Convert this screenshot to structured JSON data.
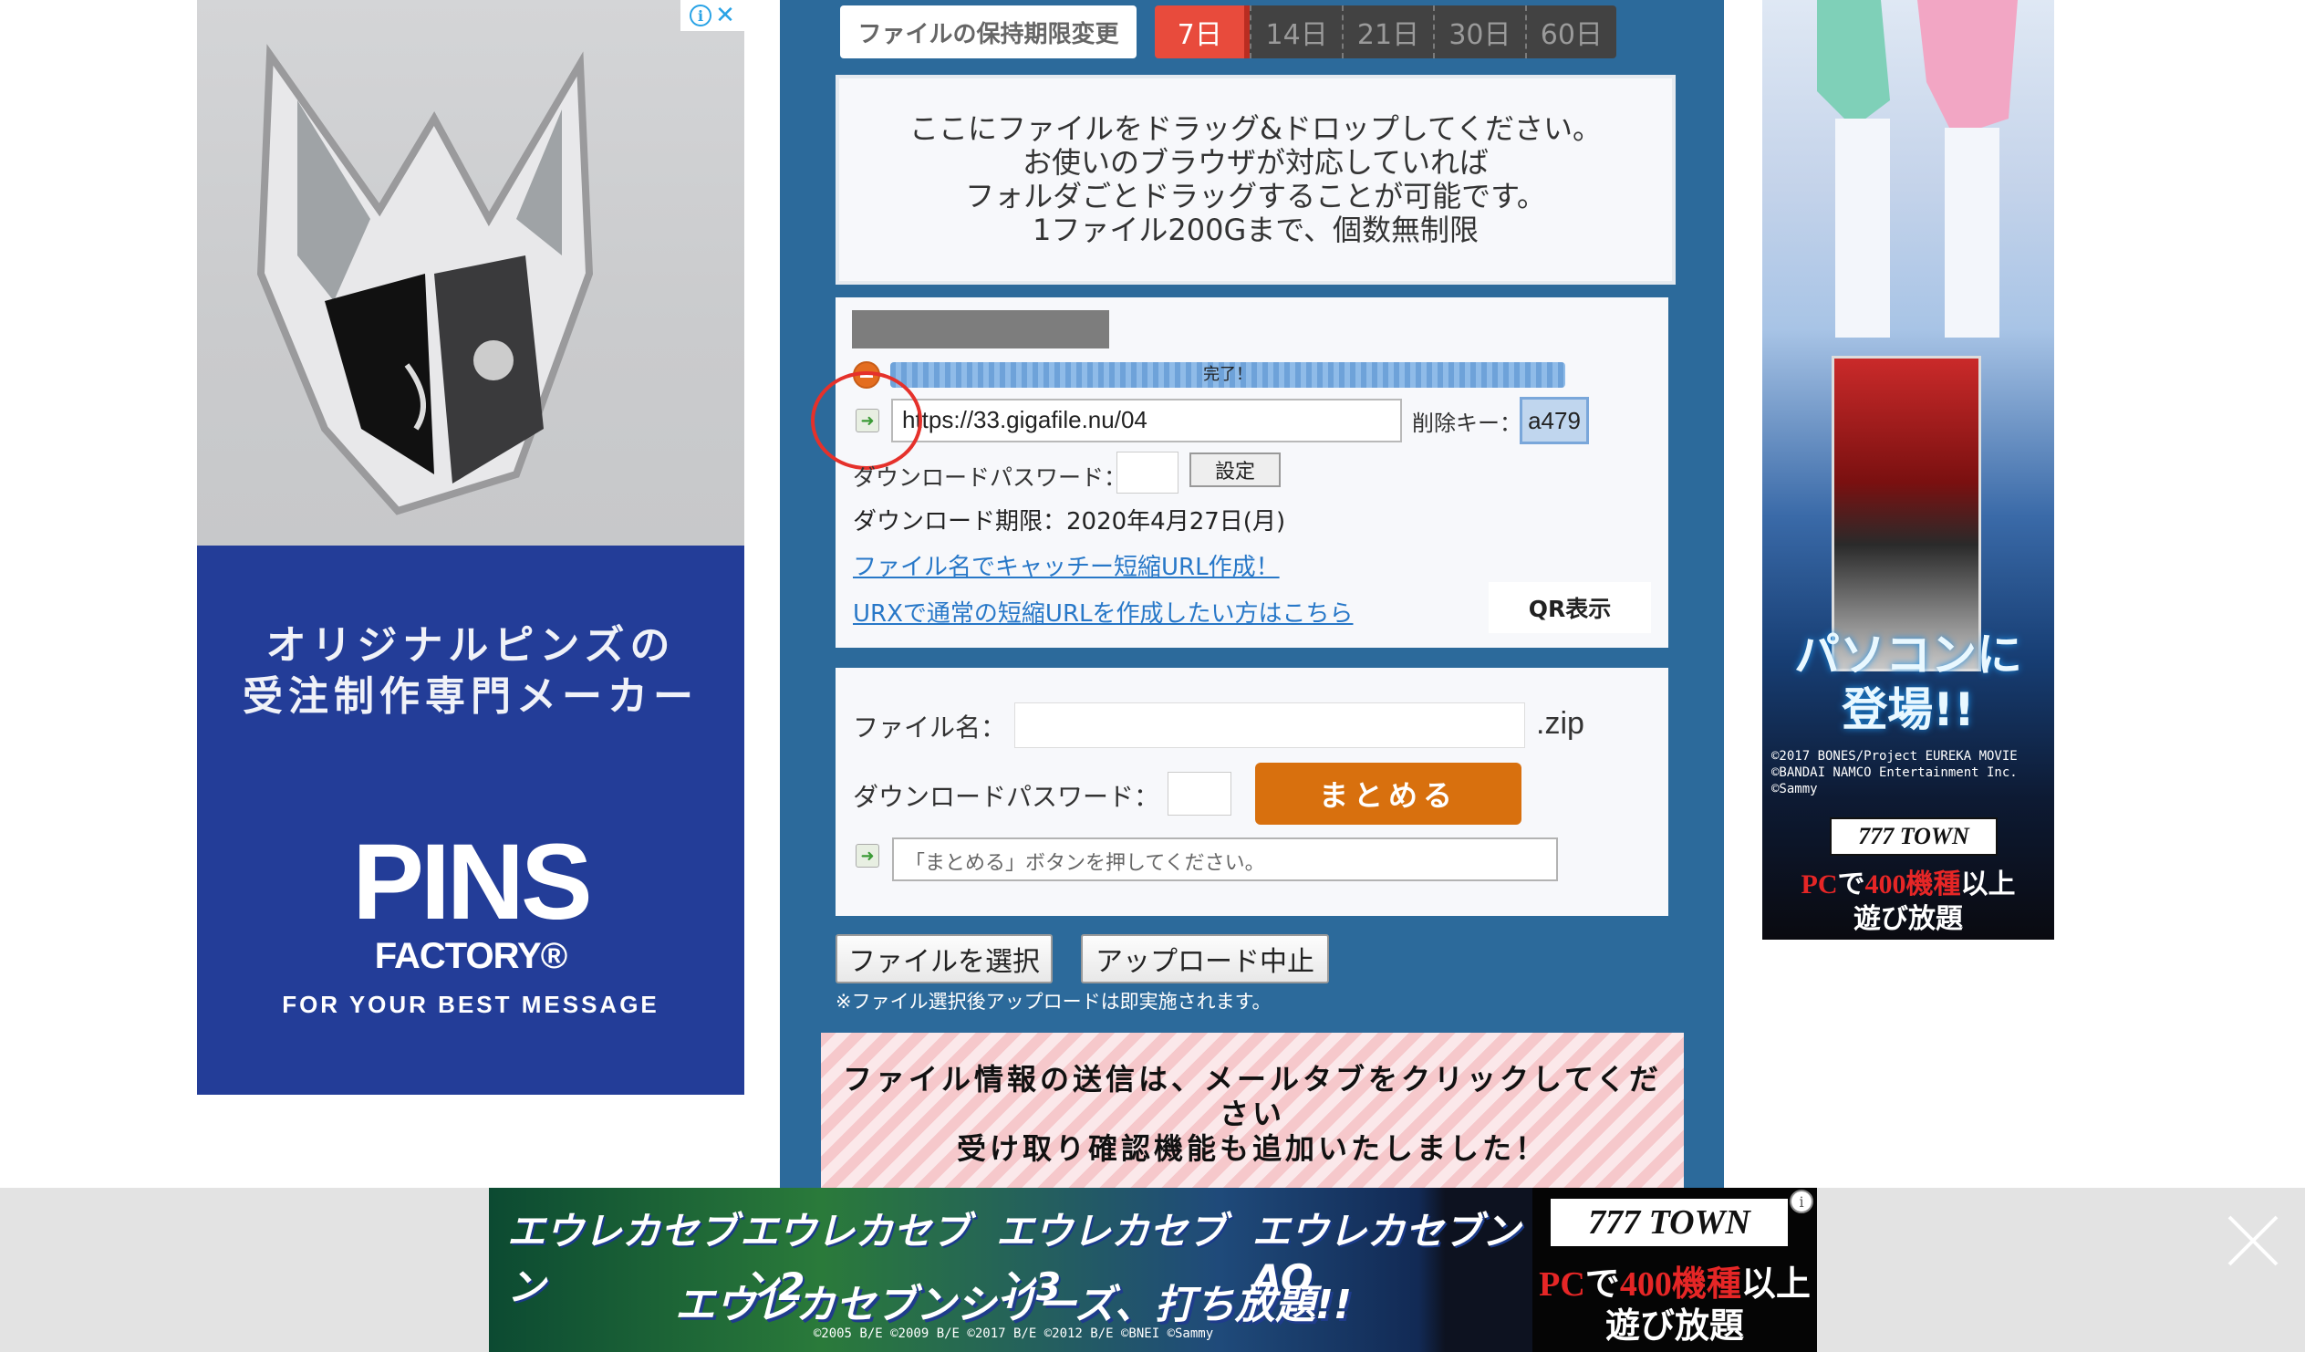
{
  "left_ad": {
    "tagline_line1": "オリジナルピンズの",
    "tagline_line2": "受注制作専門メーカー",
    "brand": "PINS",
    "brand_sub": "FACTORY®",
    "slogan": "FOR YOUR BEST MESSAGE"
  },
  "retention": {
    "label": "ファイルの保持期限変更",
    "options": [
      "7日",
      "14日",
      "21日",
      "30日",
      "60日"
    ],
    "selected": "7日"
  },
  "dropzone": {
    "line1": "ここにファイルをドラッグ&ドロップしてください。",
    "line2": "お使いのブラウザが対応していれば",
    "line3": "フォルダごとドラッグすることが可能です。",
    "line4": "1ファイル200Gまで、個数無制限"
  },
  "upload": {
    "progress_label": "完了！",
    "progress_percent": 100,
    "url": "https://33.gigafile.nu/04",
    "delete_key_label": "削除キー：",
    "delete_key": "a479",
    "download_password_label": "ダウンロードパスワード：",
    "set_button": "設定",
    "deadline": "ダウンロード期限：2020年4月27日(月)",
    "link_catchy": "ファイル名でキャッチー短縮URL作成！",
    "link_urx": "URXで通常の短縮URLを作成したい方はこちら",
    "qr_button": "QR表示"
  },
  "bundle": {
    "filename_label": "ファイル名：",
    "ext": ".zip",
    "password_label": "ダウンロードパスワード：",
    "button": "まとめる",
    "message": "「まとめる」ボタンを押してください。"
  },
  "actions": {
    "select_files": "ファイルを選択",
    "abort_upload": "アップロード中止",
    "note": "※ファイル選択後アップロードは即実施されます。"
  },
  "notice": {
    "line1": "ファイル情報の送信は、メールタブをクリックしてくだ",
    "line2": "さい",
    "line3": "受け取り確認機能も追加いたしました！"
  },
  "right_ad": {
    "heading_line1": "パソコンに",
    "heading_line2": "登場!!",
    "copyright": [
      "©2017 BONES/Project EUREKA MOVIE",
      "©BANDAI NAMCO Entertainment Inc.",
      "©Sammy"
    ],
    "brand": "777 TOWN",
    "sub_pc": "PC",
    "sub_de": "で",
    "sub_models": "400機種",
    "sub_more": "以上",
    "sub_line2": "遊び放題"
  },
  "bottom_ad": {
    "titles": [
      "エウレカセブン",
      "エウレカセブン2",
      "エウレカセブン3",
      "エウレカセブンAO"
    ],
    "slogan": "エウレカセブンシリーズ、打ち放題!!",
    "copyright": "©2005 B/E  ©2009 B/E  ©2017 B/E  ©2012 B/E  ©BNEI  ©Sammy",
    "brand": "777 TOWN",
    "sub_pc": "PC",
    "sub_de": "で",
    "sub_models": "400機種",
    "sub_more": "以上",
    "sub_line2": "遊び放題"
  }
}
